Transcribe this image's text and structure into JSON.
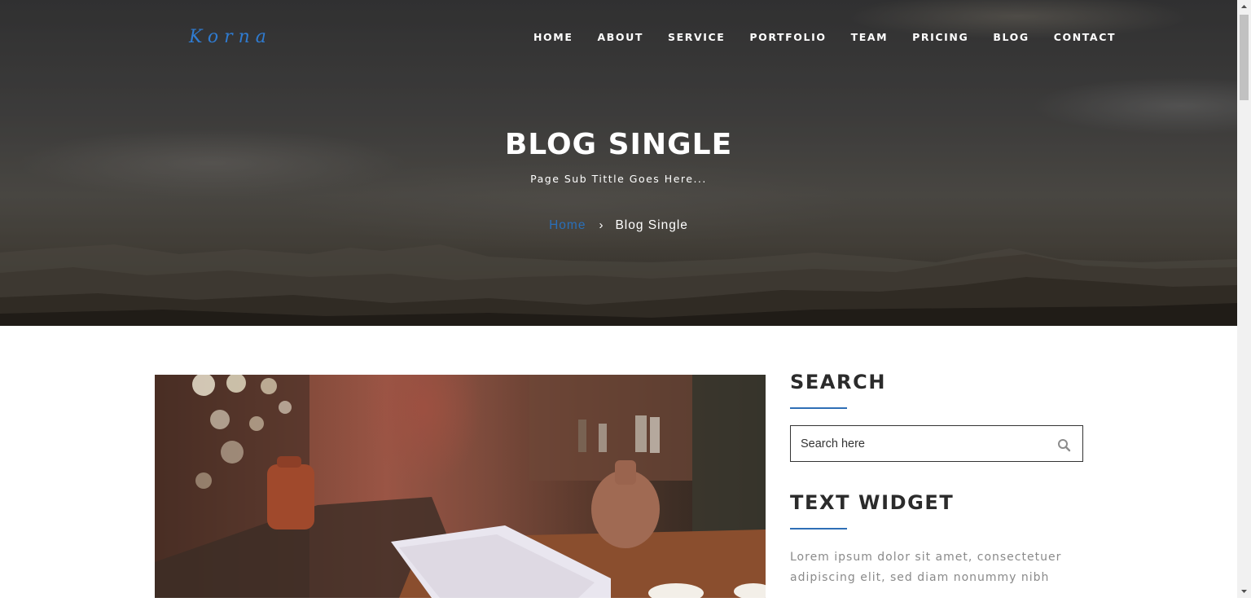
{
  "site": {
    "logo_text": "Korna",
    "brand_color": "#2f7bd0"
  },
  "nav": {
    "items": [
      {
        "label": "HOME"
      },
      {
        "label": "ABOUT"
      },
      {
        "label": "SERVICE"
      },
      {
        "label": "PORTFOLIO"
      },
      {
        "label": "TEAM"
      },
      {
        "label": "PRICING"
      },
      {
        "label": "BLOG"
      },
      {
        "label": "CONTACT"
      }
    ]
  },
  "hero": {
    "title": "BLOG SINGLE",
    "subtitle": "Page Sub Tittle Goes Here...",
    "breadcrumb": {
      "home": "Home",
      "separator": "›",
      "current": "Blog Single"
    }
  },
  "sidebar": {
    "search": {
      "title": "SEARCH",
      "placeholder": "Search here",
      "icon": "search-icon"
    },
    "text_widget": {
      "title": "TEXT WIDGET",
      "body": "Lorem ipsum dolor sit amet, consectetuer adipiscing elit, sed diam nonummy nibh"
    }
  },
  "colors": {
    "accent": "#2f6fb6",
    "heading": "#2b2b2b",
    "muted_text": "#8a8a8a"
  }
}
